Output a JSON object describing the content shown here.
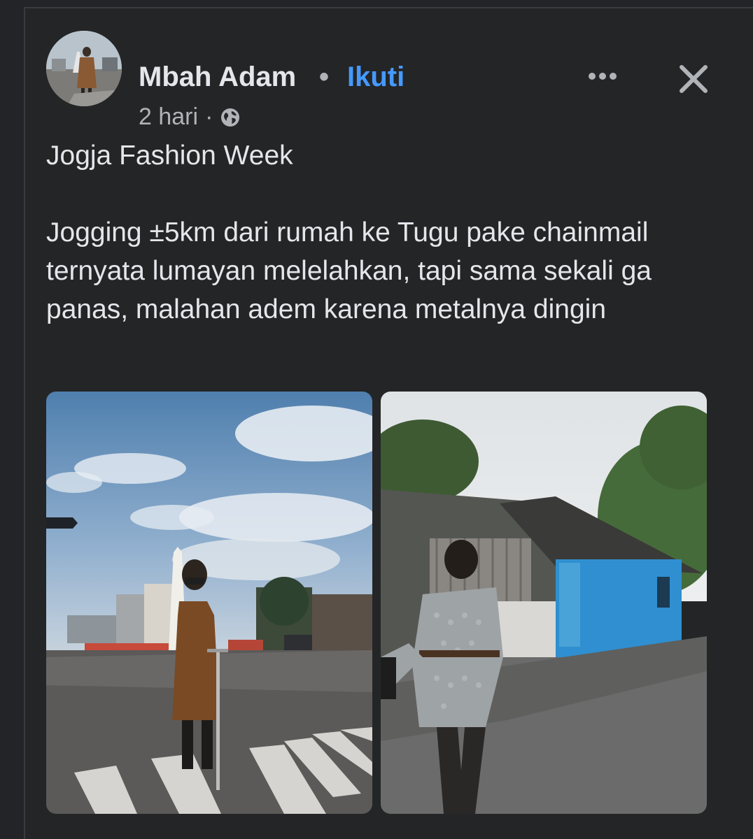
{
  "post": {
    "author": "Mbah Adam",
    "separator": "•",
    "follow_label": "Ikuti",
    "time": "2 hari",
    "meta_separator": "·",
    "privacy_icon": "globe-icon",
    "more_icon": "more-horizontal-icon",
    "close_icon": "close-icon",
    "title": "Jogja Fashion Week",
    "body": "Jogging ±5km dari rumah ke Tugu pake chainmail ternyata lumayan melelahkan, tapi sama sekali ga panas, malahan adem karena metalnya dingin"
  },
  "photos": [
    {
      "name": "photo-tugu-monument",
      "description_icon": "photo"
    },
    {
      "name": "photo-street-building",
      "description_icon": "photo"
    }
  ],
  "colors": {
    "background": "#242526",
    "text": "#e4e6eb",
    "secondary_text": "#b0b3b8",
    "link": "#4599ff"
  }
}
